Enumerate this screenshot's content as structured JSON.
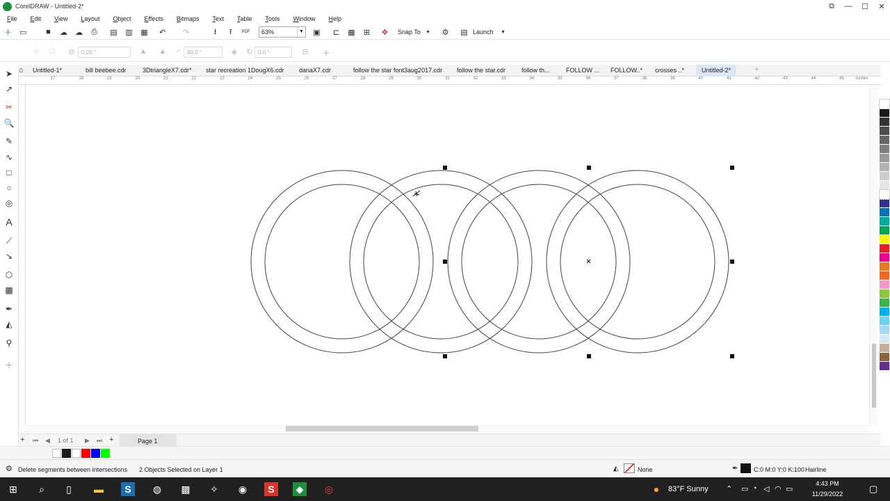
{
  "window": {
    "title": "CorelDRAW - Untitled-2*",
    "controls": [
      "restore-icon",
      "minimize-icon",
      "maximize-icon",
      "close-icon"
    ]
  },
  "menu": [
    "File",
    "Edit",
    "View",
    "Layout",
    "Object",
    "Effects",
    "Bitmaps",
    "Text",
    "Table",
    "Tools",
    "Window",
    "Help"
  ],
  "toolbar": {
    "zoom": "63%",
    "snap_to": "Snap To",
    "launch": "Launch",
    "pdf_label": "PDF"
  },
  "propbar": {
    "outline_width": "0.25 \"",
    "angle": "90.0 °",
    "angle2": "0.0 °"
  },
  "tabs": [
    "Untitled-1*",
    "bill beebee.cdr",
    "3DtriangleX7.cdr*",
    "star recreation 1DougX6.cdr",
    "danaX7.cdr",
    "follow the star font3aug2017.cdr",
    "follow the star.cdr",
    "follow th...",
    "FOLLOW ...",
    "FOLLOW..*",
    "crosses ..*",
    "Untitled-2*"
  ],
  "active_tab": "Untitled-2*",
  "ruler": {
    "ticks": [
      "17",
      "18",
      "19",
      "20",
      "21",
      "22",
      "23",
      "24",
      "25",
      "26",
      "27",
      "28",
      "29",
      "30",
      "31",
      "32",
      "33",
      "34",
      "35",
      "36",
      "37",
      "38",
      "39",
      "40",
      "41",
      "42",
      "43",
      "44",
      "45"
    ],
    "unit": "inches"
  },
  "pagenav": {
    "page_count": "1 of 1",
    "page_tab": "Page 1"
  },
  "statusbar": {
    "hint": "Delete segments between intersections",
    "selection": "2 Objects Selected on Layer 1",
    "fill": "None",
    "outline_color": "C:0 M:0 Y:0 K:100",
    "outline_width": "Hairline"
  },
  "taskbar": {
    "weather": "83°F  Sunny",
    "time": "4:43 PM",
    "date": "11/29/2022"
  },
  "colors": {
    "palette": [
      "#ffffff",
      "#1a1a1a",
      "#333333",
      "#4d4d4d",
      "#666666",
      "#808080",
      "#999999",
      "#b3b3b3",
      "#cccccc",
      "#e6e6e6",
      "#ffffff",
      "#2e3192",
      "#0072bc",
      "#00a99d",
      "#00a651",
      "#fff200",
      "#ed1c24",
      "#ec008c",
      "#ea7b1f",
      "#f26522",
      "#f49ac2",
      "#8dc63f",
      "#39b54a",
      "#00aeef",
      "#6dcff6",
      "#a3d9f5",
      "#d3e9f5",
      "#c7b299",
      "#8c6239",
      "#662d91"
    ],
    "doc_palette": [
      "#ffffff",
      "#1a1a1a",
      "#ffffff",
      "#ff0000",
      "#0000ff",
      "#00ff00"
    ]
  }
}
